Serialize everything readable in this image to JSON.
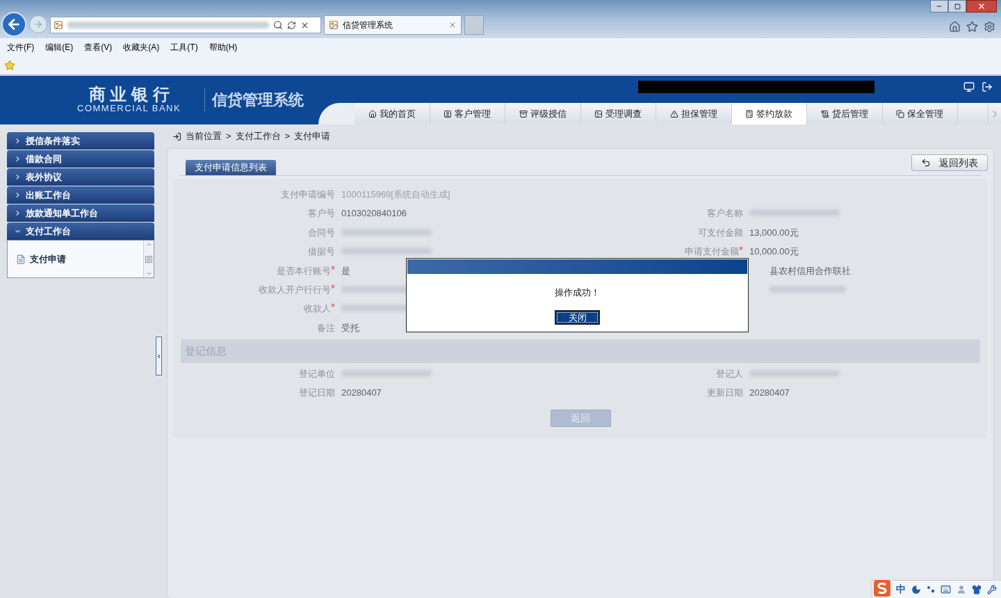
{
  "browser": {
    "tab_title": "信贷管理系统",
    "menu": [
      "文件(F)",
      "编辑(E)",
      "查看(V)",
      "收藏夹(A)",
      "工具(T)",
      "帮助(H)"
    ]
  },
  "header": {
    "bank_name": "商 业 银 行",
    "bank_name_en": "COMMERCIAL BANK",
    "system_name": "信贷管理系统"
  },
  "nav_tabs": [
    {
      "label": "我的首页",
      "kind": "home",
      "selected": false
    },
    {
      "label": "客户管理",
      "kind": "user",
      "selected": false
    },
    {
      "label": "评级授信",
      "kind": "bin",
      "selected": false
    },
    {
      "label": "受理调查",
      "kind": "image",
      "selected": false
    },
    {
      "label": "担保管理",
      "kind": "warning",
      "selected": false
    },
    {
      "label": "签约放款",
      "kind": "calc",
      "selected": true
    },
    {
      "label": "贷后管理",
      "kind": "list",
      "selected": false
    },
    {
      "label": "保全管理",
      "kind": "copy",
      "selected": false
    }
  ],
  "sidebar": [
    {
      "label": "授信条件落实",
      "expanded": false
    },
    {
      "label": "借款合同",
      "expanded": false
    },
    {
      "label": "表外协议",
      "expanded": false
    },
    {
      "label": "出账工作台",
      "expanded": false
    },
    {
      "label": "放款通知单工作台",
      "expanded": false
    },
    {
      "label": "支付工作台",
      "expanded": true,
      "children": [
        {
          "label": "支付申请"
        }
      ]
    }
  ],
  "breadcrumb": {
    "items": [
      "当前位置",
      "支付工作台",
      "支付申请"
    ],
    "separator": ">"
  },
  "panel": {
    "tab": "支付申请信息列表",
    "back_to_list": "返回列表",
    "rows": [
      {
        "left": {
          "label": "支付申请编号",
          "kind": "auto",
          "value": "1000115969[系统自动生成]",
          "required": false
        }
      },
      {
        "left": {
          "label": "客户号",
          "kind": "text",
          "value": "0103020840106",
          "required": false
        },
        "right": {
          "label": "客户名称",
          "kind": "redacted",
          "required": false
        }
      },
      {
        "left": {
          "label": "合同号",
          "kind": "redacted",
          "required": false
        },
        "right": {
          "label": "可支付金额",
          "kind": "text",
          "value": "13,000.00元",
          "required": false
        }
      },
      {
        "left": {
          "label": "借据号",
          "kind": "redacted",
          "required": false
        },
        "right": {
          "label": "申请支付金额",
          "kind": "text",
          "value": "10,000.00元",
          "required": true
        }
      },
      {
        "left": {
          "label": "是否本行账号",
          "kind": "text",
          "value": "是",
          "required": true
        },
        "right": {
          "kind": "covered",
          "value": "县农村信用合作联社"
        }
      },
      {
        "left": {
          "label": "收款人开户行行号",
          "kind": "redacted",
          "required": true
        },
        "right": {
          "kind": "covered-redacted"
        }
      },
      {
        "left": {
          "label": "收款人",
          "kind": "redacted",
          "required": true
        }
      },
      {
        "left": {
          "label": "备注",
          "kind": "text",
          "value": "受托",
          "required": false
        }
      }
    ],
    "section_title": "登记信息",
    "reg_rows": [
      {
        "left": {
          "label": "登记单位",
          "kind": "redacted",
          "required": false
        },
        "right": {
          "label": "登记人",
          "kind": "redacted",
          "required": false
        }
      },
      {
        "left": {
          "label": "登记日期",
          "kind": "text",
          "value": "20280407",
          "required": false
        },
        "right": {
          "label": "更新日期",
          "kind": "text",
          "value": "20280407",
          "required": false
        }
      }
    ],
    "back_button": {
      "label": "返回",
      "disabled": true
    }
  },
  "dialog": {
    "message": "操作成功！",
    "close_button": "关闭"
  },
  "ime": {
    "mode": "中"
  }
}
